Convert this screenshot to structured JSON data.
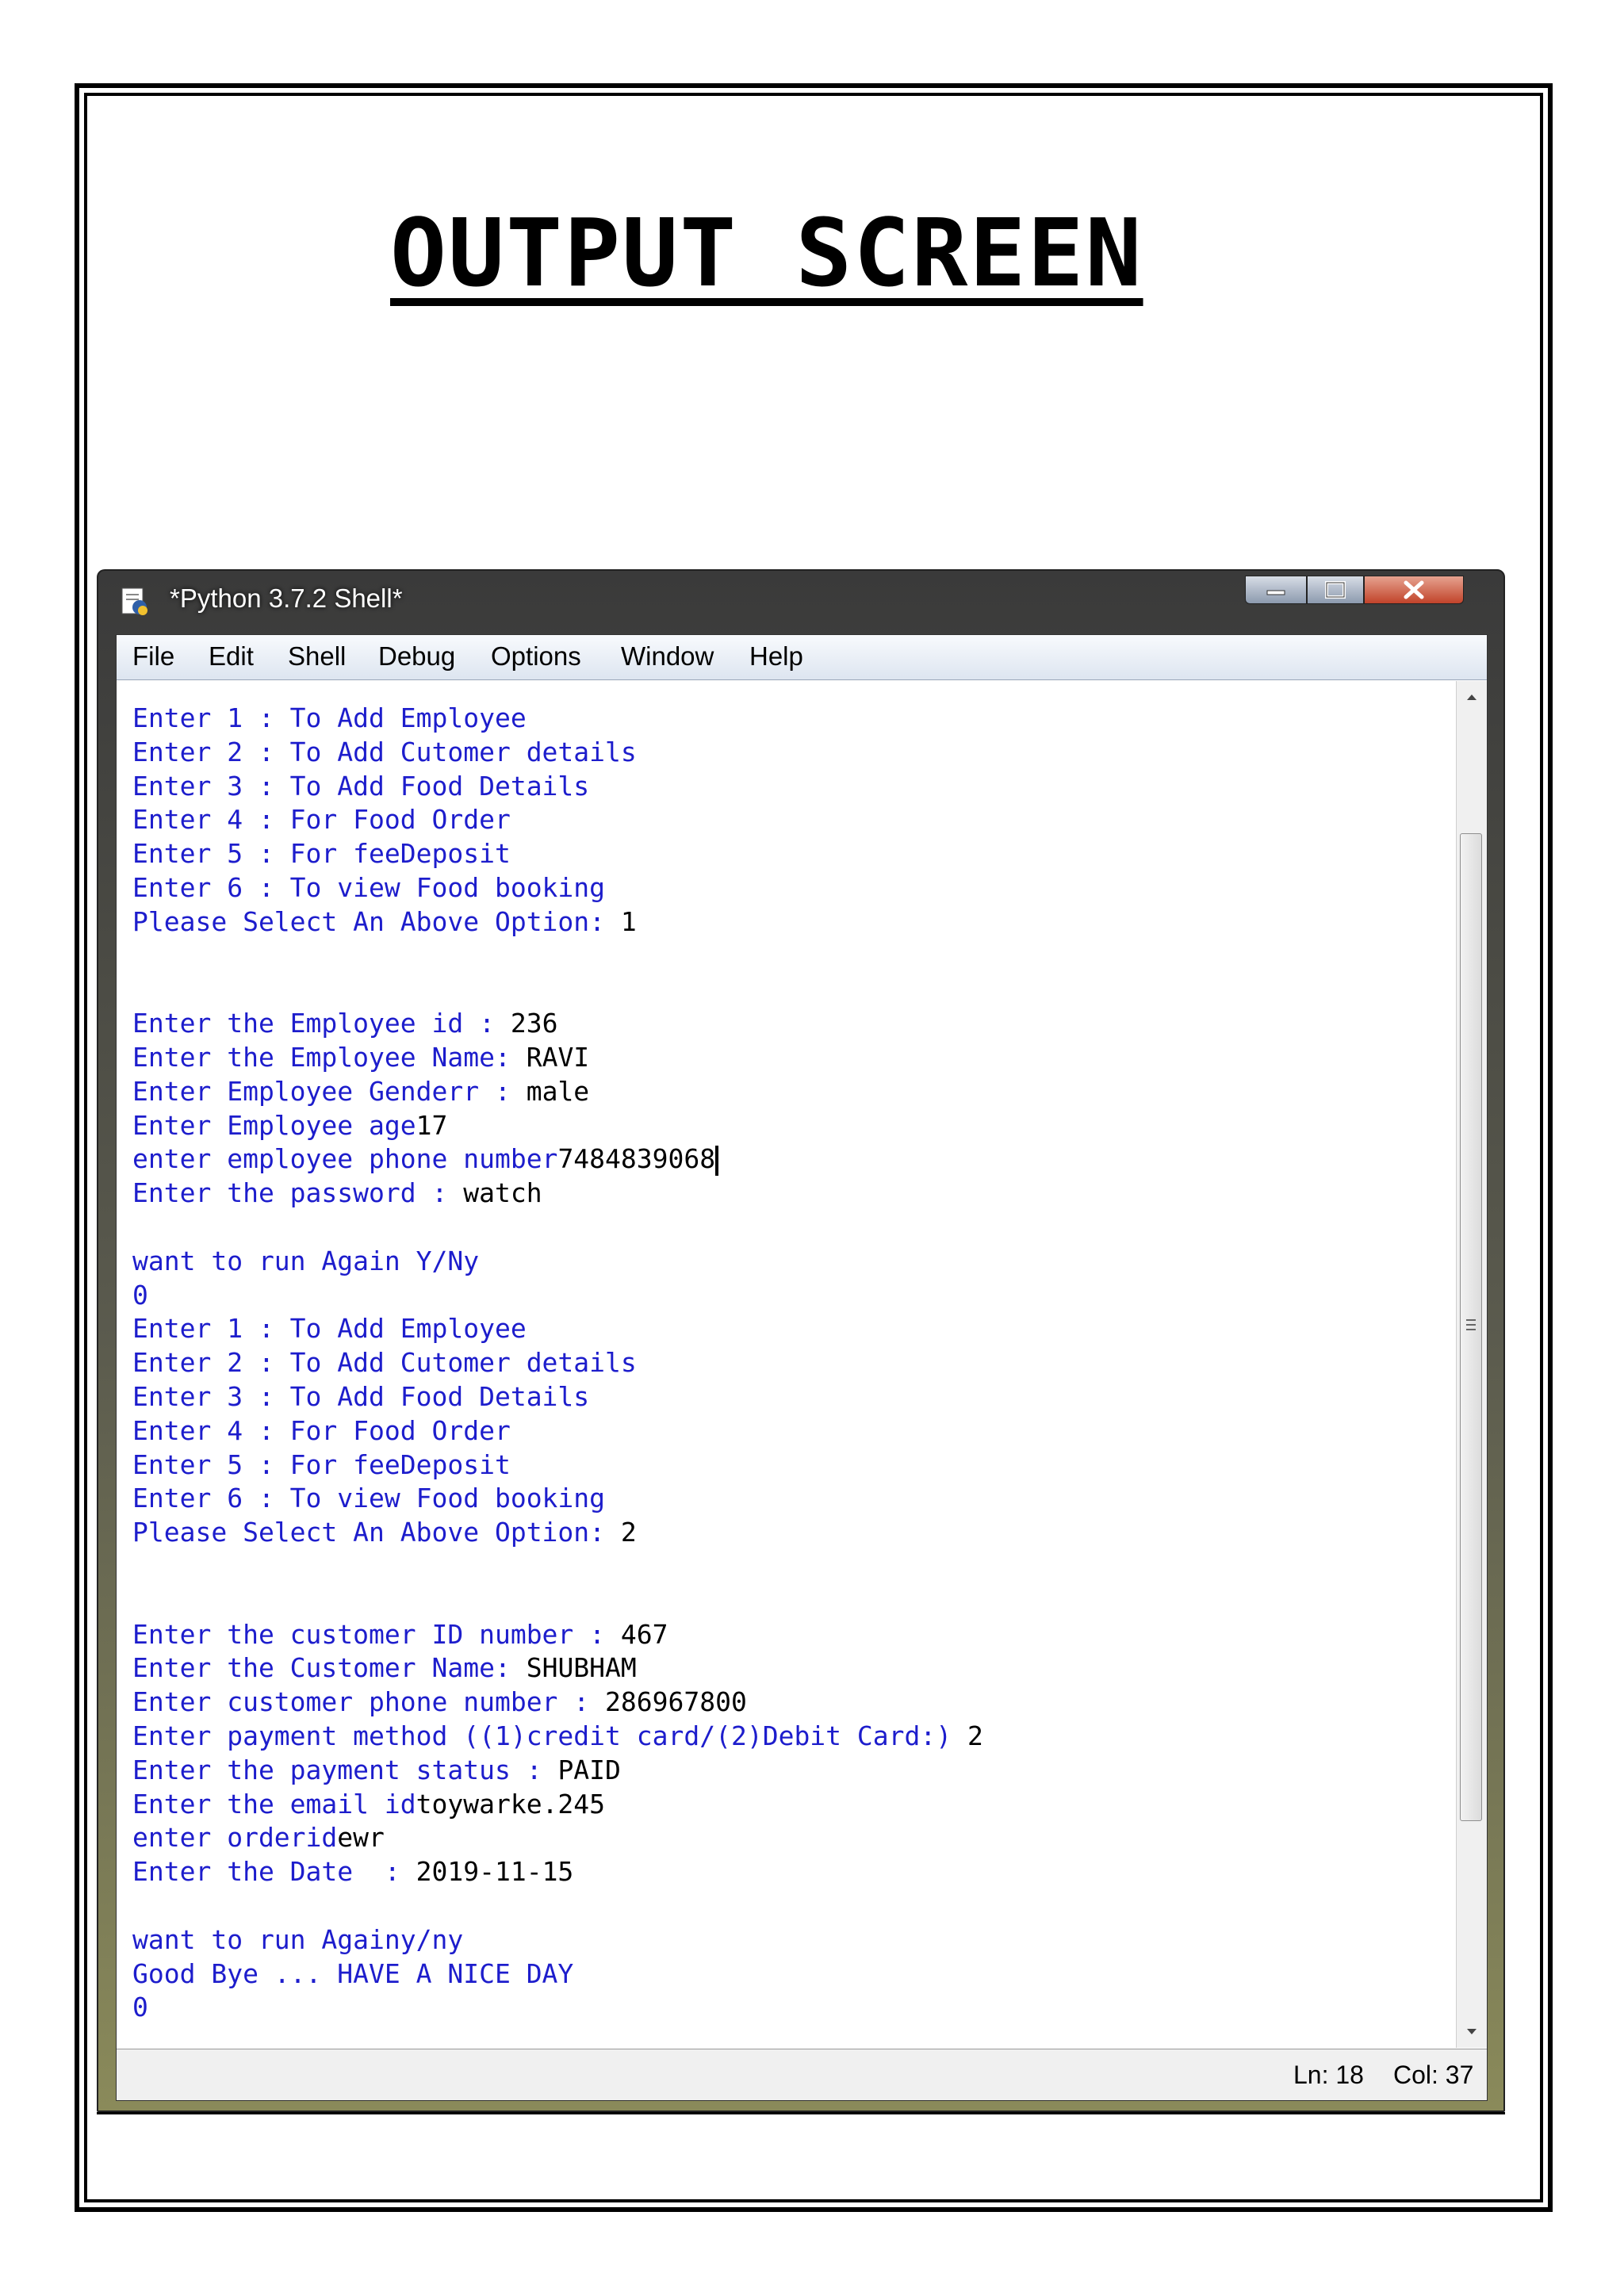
{
  "page": {
    "title": "OUTPUT SCREEN"
  },
  "window": {
    "title": "*Python 3.7.2 Shell*"
  },
  "menu": [
    "File",
    "Edit",
    "Shell",
    "Debug",
    "Options",
    "Window",
    "Help"
  ],
  "shell_lines": [
    {
      "p": "Enter 1 : To Add Employee",
      "u": ""
    },
    {
      "p": "Enter 2 : To Add Cutomer details",
      "u": ""
    },
    {
      "p": "Enter 3 : To Add Food Details",
      "u": ""
    },
    {
      "p": "Enter 4 : For Food Order",
      "u": ""
    },
    {
      "p": "Enter 5 : For feeDeposit",
      "u": ""
    },
    {
      "p": "Enter 6 : To view Food booking",
      "u": ""
    },
    {
      "p": "Please Select An Above Option: ",
      "u": "1"
    },
    {
      "p": "",
      "u": ""
    },
    {
      "p": "",
      "u": ""
    },
    {
      "p": "Enter the Employee id : ",
      "u": "236"
    },
    {
      "p": "Enter the Employee Name: ",
      "u": "RAVI"
    },
    {
      "p": "Enter Employee Genderr : ",
      "u": "male"
    },
    {
      "p": "Enter Employee age",
      "u": "17"
    },
    {
      "p": "enter employee phone number",
      "u": "7484839068",
      "caret": true
    },
    {
      "p": "Enter the password : ",
      "u": "watch"
    },
    {
      "p": "",
      "u": ""
    },
    {
      "p": "want to run Again Y/Ny",
      "u": ""
    },
    {
      "p": "0",
      "u": ""
    },
    {
      "p": "Enter 1 : To Add Employee",
      "u": ""
    },
    {
      "p": "Enter 2 : To Add Cutomer details",
      "u": ""
    },
    {
      "p": "Enter 3 : To Add Food Details",
      "u": ""
    },
    {
      "p": "Enter 4 : For Food Order",
      "u": ""
    },
    {
      "p": "Enter 5 : For feeDeposit",
      "u": ""
    },
    {
      "p": "Enter 6 : To view Food booking",
      "u": ""
    },
    {
      "p": "Please Select An Above Option: ",
      "u": "2"
    },
    {
      "p": "",
      "u": ""
    },
    {
      "p": "",
      "u": ""
    },
    {
      "p": "Enter the customer ID number : ",
      "u": "467"
    },
    {
      "p": "Enter the Customer Name: ",
      "u": "SHUBHAM"
    },
    {
      "p": "Enter customer phone number : ",
      "u": "286967800"
    },
    {
      "p": "Enter payment method ((1)credit card/(2)Debit Card:) ",
      "u": "2"
    },
    {
      "p": "Enter the payment status : ",
      "u": "PAID"
    },
    {
      "p": "Enter the email id",
      "u": "toywarke.245"
    },
    {
      "p": "enter orderid",
      "u": "ewr"
    },
    {
      "p": "Enter the Date  : ",
      "u": "2019-11-15"
    },
    {
      "p": "",
      "u": ""
    },
    {
      "p": "want to run Againy/ny",
      "u": ""
    },
    {
      "p": "Good Bye ... HAVE A NICE DAY",
      "u": ""
    },
    {
      "p": "0",
      "u": ""
    }
  ],
  "status": {
    "ln": "Ln: 18",
    "col": "Col: 37"
  },
  "colors": {
    "prompt": "#1d1dcc",
    "input": "#000000"
  }
}
